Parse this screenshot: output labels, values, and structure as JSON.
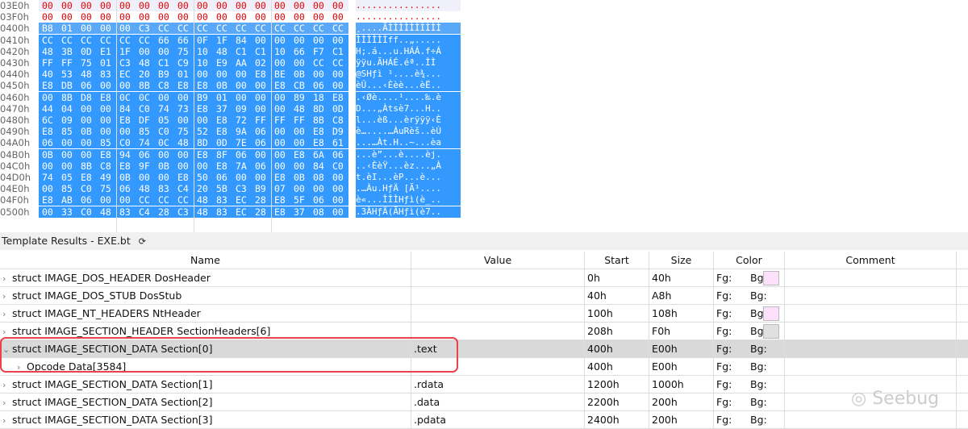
{
  "hex_rows": [
    {
      "addr": "03E0h",
      "bytes": [
        "00",
        "00",
        "00",
        "00",
        "00",
        "00",
        "00",
        "00",
        "00",
        "00",
        "00",
        "00",
        "00",
        "00",
        "00",
        "00"
      ],
      "ascii": "................"
    },
    {
      "addr": "03F0h",
      "bytes": [
        "00",
        "00",
        "00",
        "00",
        "00",
        "00",
        "00",
        "00",
        "00",
        "00",
        "00",
        "00",
        "00",
        "00",
        "00",
        "00"
      ],
      "ascii": "................"
    },
    {
      "addr": "0400h",
      "bytes": [
        "B8",
        "01",
        "00",
        "00",
        "00",
        "C3",
        "CC",
        "CC",
        "CC",
        "CC",
        "CC",
        "CC",
        "CC",
        "CC",
        "CC",
        "CC"
      ],
      "ascii": "¸....ÃÌÌÌÌÌÌÌÌÌÌ"
    },
    {
      "addr": "0410h",
      "bytes": [
        "CC",
        "CC",
        "CC",
        "CC",
        "CC",
        "CC",
        "66",
        "66",
        "0F",
        "1F",
        "84",
        "00",
        "00",
        "00",
        "00",
        "00"
      ],
      "ascii": "ÌÌÌÌÌÌff..„....."
    },
    {
      "addr": "0420h",
      "bytes": [
        "48",
        "3B",
        "0D",
        "E1",
        "1F",
        "00",
        "00",
        "75",
        "10",
        "48",
        "C1",
        "C1",
        "10",
        "66",
        "F7",
        "C1"
      ],
      "ascii": "H;.á...u.HÁÁ.f÷Á"
    },
    {
      "addr": "0430h",
      "bytes": [
        "FF",
        "FF",
        "75",
        "01",
        "C3",
        "48",
        "C1",
        "C9",
        "10",
        "E9",
        "AA",
        "02",
        "00",
        "00",
        "CC",
        "CC"
      ],
      "ascii": "ÿÿu.ÃHÁÉ.éª..ÌÌ"
    },
    {
      "addr": "0440h",
      "bytes": [
        "40",
        "53",
        "48",
        "83",
        "EC",
        "20",
        "B9",
        "01",
        "00",
        "00",
        "00",
        "E8",
        "BE",
        "0B",
        "00",
        "00"
      ],
      "ascii": "@SHƒì ¹....è¾..."
    },
    {
      "addr": "0450h",
      "bytes": [
        "E8",
        "DB",
        "06",
        "00",
        "00",
        "8B",
        "C8",
        "E8",
        "E8",
        "0B",
        "00",
        "00",
        "E8",
        "CB",
        "06",
        "00"
      ],
      "ascii": "èÛ...‹Èèè...èË.."
    },
    {
      "addr": "0460h",
      "bytes": [
        "00",
        "8B",
        "D8",
        "E8",
        "0C",
        "0C",
        "00",
        "00",
        "B9",
        "01",
        "00",
        "00",
        "00",
        "89",
        "18",
        "E8"
      ],
      "ascii": ".‹Øè....¹....‰.è"
    },
    {
      "addr": "0470h",
      "bytes": [
        "44",
        "04",
        "00",
        "00",
        "84",
        "C0",
        "74",
        "73",
        "E8",
        "37",
        "09",
        "00",
        "00",
        "48",
        "8D",
        "0D"
      ],
      "ascii": "D...„Àtsè7...H.."
    },
    {
      "addr": "0480h",
      "bytes": [
        "6C",
        "09",
        "00",
        "00",
        "E8",
        "DF",
        "05",
        "00",
        "00",
        "E8",
        "72",
        "FF",
        "FF",
        "FF",
        "8B",
        "C8"
      ],
      "ascii": "l...èß...èrÿÿÿ‹È"
    },
    {
      "addr": "0490h",
      "bytes": [
        "E8",
        "85",
        "0B",
        "00",
        "00",
        "85",
        "C0",
        "75",
        "52",
        "E8",
        "9A",
        "06",
        "00",
        "00",
        "E8",
        "D9"
      ],
      "ascii": "è…....…ÀuRèš..èÙ"
    },
    {
      "addr": "04A0h",
      "bytes": [
        "06",
        "00",
        "00",
        "85",
        "C0",
        "74",
        "0C",
        "48",
        "8D",
        "0D",
        "7E",
        "06",
        "00",
        "00",
        "E8",
        "61"
      ],
      "ascii": "...…Àt.H..~...èa"
    },
    {
      "addr": "04B0h",
      "bytes": [
        "0B",
        "00",
        "00",
        "E8",
        "94",
        "06",
        "00",
        "00",
        "E8",
        "8F",
        "06",
        "00",
        "00",
        "E8",
        "6A",
        "06"
      ],
      "ascii": "...è”...è....èj."
    },
    {
      "addr": "04C0h",
      "bytes": [
        "00",
        "00",
        "8B",
        "C8",
        "E8",
        "9F",
        "0B",
        "00",
        "00",
        "E8",
        "7A",
        "06",
        "00",
        "00",
        "84",
        "C0"
      ],
      "ascii": "..‹ÈèŸ...èz...„À"
    },
    {
      "addr": "04D0h",
      "bytes": [
        "74",
        "05",
        "E8",
        "49",
        "0B",
        "00",
        "00",
        "E8",
        "50",
        "06",
        "00",
        "00",
        "E8",
        "0B",
        "08",
        "00"
      ],
      "ascii": "t.èI...èP...è..."
    },
    {
      "addr": "04E0h",
      "bytes": [
        "00",
        "85",
        "C0",
        "75",
        "06",
        "48",
        "83",
        "C4",
        "20",
        "5B",
        "C3",
        "B9",
        "07",
        "00",
        "00",
        "00"
      ],
      "ascii": ".…Àu.HƒÄ [Ã¹...."
    },
    {
      "addr": "04F0h",
      "bytes": [
        "E8",
        "AB",
        "06",
        "00",
        "00",
        "CC",
        "CC",
        "CC",
        "48",
        "83",
        "EC",
        "28",
        "E8",
        "5F",
        "06",
        "00"
      ],
      "ascii": "è«...ÌÌÌHƒì(è_.."
    },
    {
      "addr": "0500h",
      "bytes": [
        "00",
        "33",
        "C0",
        "48",
        "83",
        "C4",
        "28",
        "C3",
        "48",
        "83",
        "EC",
        "28",
        "E8",
        "37",
        "08",
        "00"
      ],
      "ascii": ".3ÀHƒÄ(ÃHƒì(è7.."
    }
  ],
  "template": {
    "title": "Template Results - EXE.bt",
    "refresh_icon": "refresh-icon"
  },
  "columns": [
    "Name",
    "Value",
    "Start",
    "Size",
    "Color",
    "Comment"
  ],
  "rows": [
    {
      "name": "struct IMAGE_DOS_HEADER DosHeader",
      "value": "",
      "start": "0h",
      "size": "40h",
      "fg": "Fg:",
      "bg": "Bg:",
      "swatch": "#fde0fa",
      "indent": 0
    },
    {
      "name": "struct IMAGE_DOS_STUB DosStub",
      "value": "",
      "start": "40h",
      "size": "A8h",
      "fg": "Fg:",
      "bg": "Bg:",
      "swatch": null,
      "indent": 0
    },
    {
      "name": "struct IMAGE_NT_HEADERS NtHeader",
      "value": "",
      "start": "100h",
      "size": "108h",
      "fg": "Fg:",
      "bg": "Bg:",
      "swatch": "#fde0fa",
      "indent": 0
    },
    {
      "name": "struct IMAGE_SECTION_HEADER SectionHeaders[6]",
      "value": "",
      "start": "208h",
      "size": "F0h",
      "fg": "Fg:",
      "bg": "Bg:",
      "swatch": "#e0e0e0",
      "indent": 0
    },
    {
      "name": "struct IMAGE_SECTION_DATA Section[0]",
      "value": ".text",
      "start": "400h",
      "size": "E00h",
      "fg": "Fg:",
      "bg": "Bg:",
      "swatch": null,
      "indent": 0,
      "expanded": true,
      "selected": true
    },
    {
      "name": "Opcode Data[3584]",
      "value": "",
      "start": "400h",
      "size": "E00h",
      "fg": "Fg:",
      "bg": "Bg:",
      "swatch": null,
      "indent": 1
    },
    {
      "name": "struct IMAGE_SECTION_DATA Section[1]",
      "value": ".rdata",
      "start": "1200h",
      "size": "1000h",
      "fg": "Fg:",
      "bg": "Bg:",
      "swatch": null,
      "indent": 0
    },
    {
      "name": "struct IMAGE_SECTION_DATA Section[2]",
      "value": ".data",
      "start": "2200h",
      "size": "200h",
      "fg": "Fg:",
      "bg": "Bg:",
      "swatch": null,
      "indent": 0
    },
    {
      "name": "struct IMAGE_SECTION_DATA Section[3]",
      "value": ".pdata",
      "start": "2400h",
      "size": "200h",
      "fg": "Fg:",
      "bg": "Bg:",
      "swatch": null,
      "indent": 0
    }
  ],
  "watermark": "Seebug"
}
